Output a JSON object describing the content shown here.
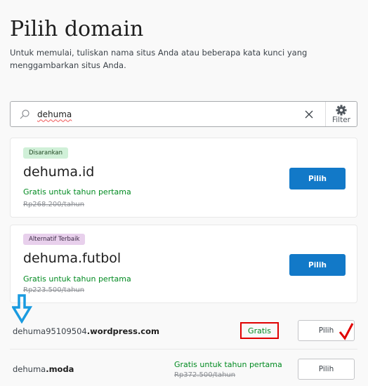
{
  "header": {
    "title": "Pilih domain",
    "description": "Untuk memulai, tuliskan nama situs Anda atau beberapa kata kunci yang menggambarkan situs Anda."
  },
  "search": {
    "value": "dehuma",
    "icon": "search-icon",
    "clear_icon": "close-icon",
    "filter_label": "Filter",
    "filter_icon": "gear-icon"
  },
  "featured": [
    {
      "badge": "Disarankan",
      "badge_color": "#d0f0d8",
      "domain": "dehuma.id",
      "offer": "Gratis untuk tahun pertama",
      "old_price": "Rp268.200/tahun",
      "button": "Pilih"
    },
    {
      "badge": "Alternatif Terbaik",
      "badge_color": "#e8d0ec",
      "domain": "dehuma.futbol",
      "offer": "Gratis untuk tahun pertama",
      "old_price": "Rp223.500/tahun",
      "button": "Pilih"
    }
  ],
  "rows": [
    {
      "name": "dehuma95109504",
      "tld": ".wordpress.com",
      "price": "Gratis",
      "button": "Pilih"
    },
    {
      "name": "dehuma",
      "tld": ".moda",
      "offer": "Gratis untuk tahun pertama",
      "old_price": "Rp372.500/tahun",
      "button": "Pilih"
    }
  ],
  "colors": {
    "accent": "#1279c8",
    "green": "#008a20",
    "annotation_red": "#e00000",
    "annotation_blue": "#1a9be0"
  }
}
